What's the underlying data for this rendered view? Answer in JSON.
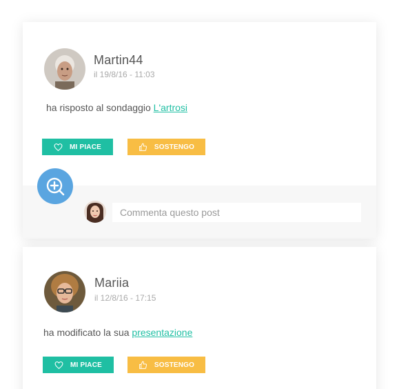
{
  "posts": [
    {
      "username": "Martin44",
      "timestamp": "il 19/8/16 - 11:03",
      "activity_text": "ha risposto al sondaggio ",
      "activity_link": "L'artrosi",
      "like_label": "MI PIACE",
      "support_label": "SOSTENGO"
    },
    {
      "username": "Mariia",
      "timestamp": "il 12/8/16 - 17:15",
      "activity_text": "ha modificato la sua ",
      "activity_link": "presentazione",
      "like_label": "MI PIACE",
      "support_label": "SOSTENGO"
    }
  ],
  "comment": {
    "placeholder": "Commenta questo post"
  },
  "colors": {
    "accent_green": "#1fbfa3",
    "accent_yellow": "#f8bd44",
    "fab_blue": "#5aa5e0"
  },
  "icons": {
    "like": "heart-icon",
    "support": "thumbs-up-icon",
    "add_comment": "zoom-plus-icon"
  }
}
